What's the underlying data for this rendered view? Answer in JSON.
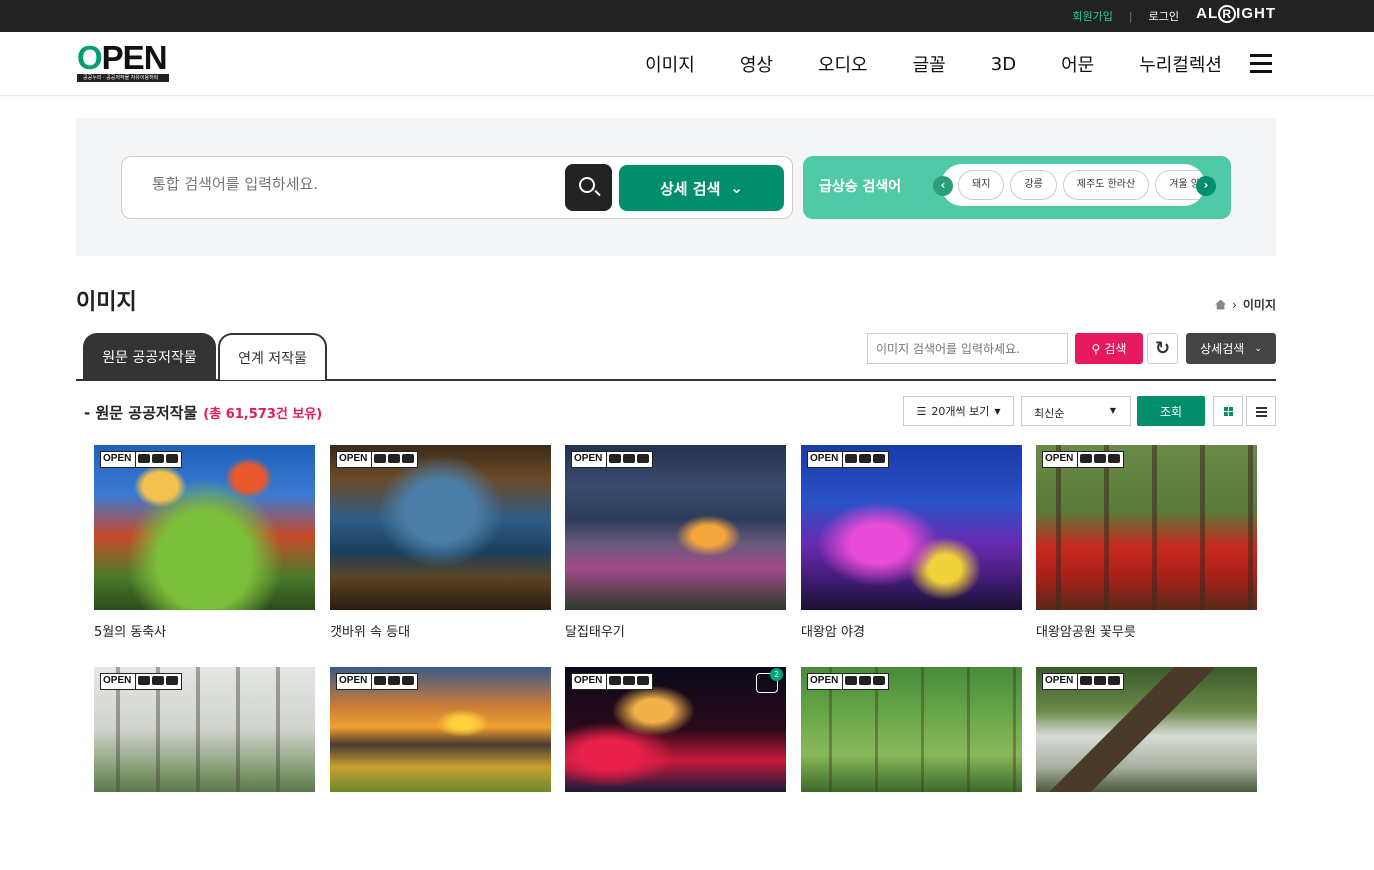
{
  "topbar": {
    "join": "회원가입",
    "separator": "|",
    "login": "로그인",
    "brand": "ALRIGHT"
  },
  "logo": {
    "word": "OPEN",
    "sub": "공공누리 · 공공저작물 자유이용허락"
  },
  "nav": [
    "이미지",
    "영상",
    "오디오",
    "글꼴",
    "3D",
    "어문",
    "누리컬렉션"
  ],
  "search": {
    "placeholder": "통합 검색어를 입력하세요.",
    "detail_label": "상세 검색",
    "trend_label": "급상승 검색어",
    "trend_items": [
      "돼지",
      "강릉",
      "제주도 한라산",
      "겨울 양"
    ]
  },
  "page": {
    "title": "이미지",
    "breadcrumb_current": "이미지"
  },
  "tabs": {
    "active": "원문 공공저작물",
    "inactive": "연계 저작물"
  },
  "image_search": {
    "placeholder": "이미지 검색어를 입력하세요.",
    "button": "검색",
    "detail": "상세검색"
  },
  "section": {
    "title": "- 원문 공공저작물",
    "count": "(총  61,573건 보유)"
  },
  "controls": {
    "per_page": "20개씩 보기",
    "sort": "최신순",
    "view": "조회"
  },
  "colors": {
    "brand_green": "#008f6a",
    "accent_pink": "#e6195e",
    "trend_green": "#4fc9a6"
  },
  "gallery": {
    "row1": [
      {
        "caption": "5월의 동축사"
      },
      {
        "caption": "갯바위 속 등대"
      },
      {
        "caption": "달집태우기"
      },
      {
        "caption": "대왕암 야경"
      },
      {
        "caption": "대왕암공원 꽃무릇"
      }
    ],
    "row2_multi_count": "2"
  }
}
